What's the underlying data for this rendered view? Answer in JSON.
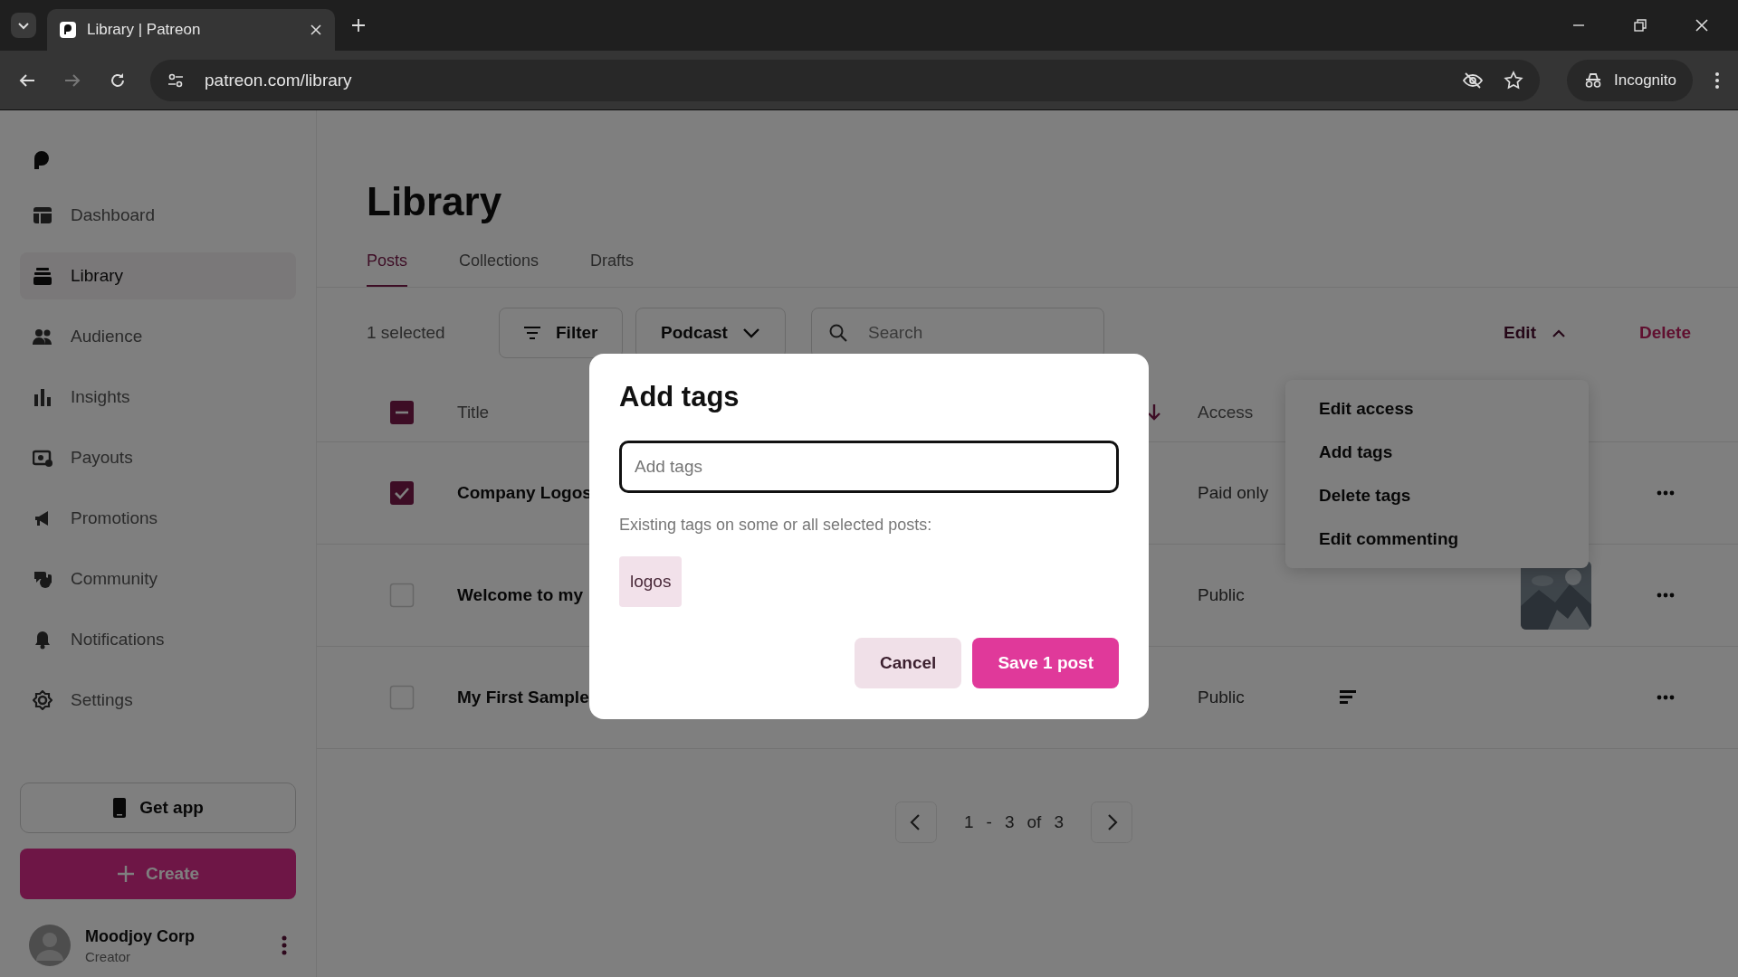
{
  "browser": {
    "tabs": [
      {
        "title": "Library | Patreon",
        "selected": true
      }
    ],
    "url": "patreon.com/library",
    "profile": "Incognito"
  },
  "sidebar": {
    "items": [
      {
        "label": "Dashboard",
        "selected": false
      },
      {
        "label": "Library",
        "selected": true
      },
      {
        "label": "Audience",
        "selected": false
      },
      {
        "label": "Insights",
        "selected": false
      },
      {
        "label": "Payouts",
        "selected": false
      },
      {
        "label": "Promotions",
        "selected": false
      },
      {
        "label": "Community",
        "selected": false
      },
      {
        "label": "Notifications",
        "selected": false
      },
      {
        "label": "Settings",
        "selected": false
      }
    ],
    "get_app": "Get app",
    "create": "Create",
    "user": {
      "name": "Moodjoy Corp",
      "role": "Creator"
    }
  },
  "page": {
    "title": "Library",
    "tabs": [
      {
        "label": "Posts",
        "selected": true
      },
      {
        "label": "Collections",
        "selected": false
      },
      {
        "label": "Drafts",
        "selected": false
      }
    ],
    "toolbar": {
      "selected_count": "1 selected",
      "filter": "Filter",
      "type_dropdown": "Podcast",
      "search": {
        "placeholder": "Search"
      },
      "edit_menu": {
        "label": "Edit",
        "expanded": true,
        "items": [
          "Edit access",
          "Add tags",
          "Delete tags",
          "Edit commenting"
        ]
      },
      "delete": "Delete"
    },
    "table": {
      "indeterminate": true,
      "columns": [
        "Title",
        "Access"
      ],
      "rows": [
        {
          "title": "Company Logos",
          "access": "Paid only",
          "checked": true,
          "kind": "plain"
        },
        {
          "title": "Welcome to my",
          "access": "Public",
          "checked": false
        },
        {
          "title": "My First Sample",
          "access": "Public",
          "checked": false,
          "kind": "text"
        }
      ]
    },
    "pagination": [
      "1",
      "-",
      "3",
      "of",
      "3"
    ]
  },
  "dialog": {
    "title": "Add tags",
    "input": {
      "placeholder": "Add tags"
    },
    "hint": "Existing tags on some or all selected posts:",
    "tags": [
      "logos"
    ],
    "buttons": [
      {
        "label": "Cancel",
        "kind": "secondary"
      },
      {
        "label": "Save 1 post",
        "kind": "primary"
      }
    ]
  }
}
